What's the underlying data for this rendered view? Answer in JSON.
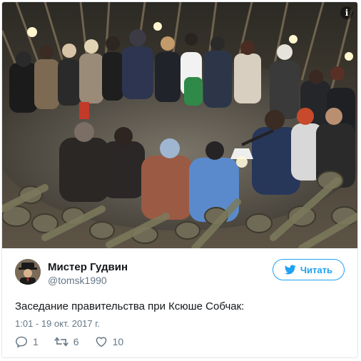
{
  "tweet": {
    "author": {
      "display_name": "Мистер Гудвин",
      "handle": "@tomsk1990",
      "avatar_icon": "avatar-man-in-hat"
    },
    "follow_button": {
      "label": "Читать",
      "icon": "twitter-bird-icon"
    },
    "text": "Заседание правительства при Ксюше Собчак:",
    "timestamp": "1:01 - 19 окт. 2017 г.",
    "actions": {
      "reply_count": "1",
      "retweet_count": "6",
      "like_count": "10"
    },
    "media": {
      "info_icon": "info-icon"
    }
  },
  "colors": {
    "accent": "#1da1f2",
    "secondary_text": "#657786",
    "border": "#e1e8ed"
  }
}
